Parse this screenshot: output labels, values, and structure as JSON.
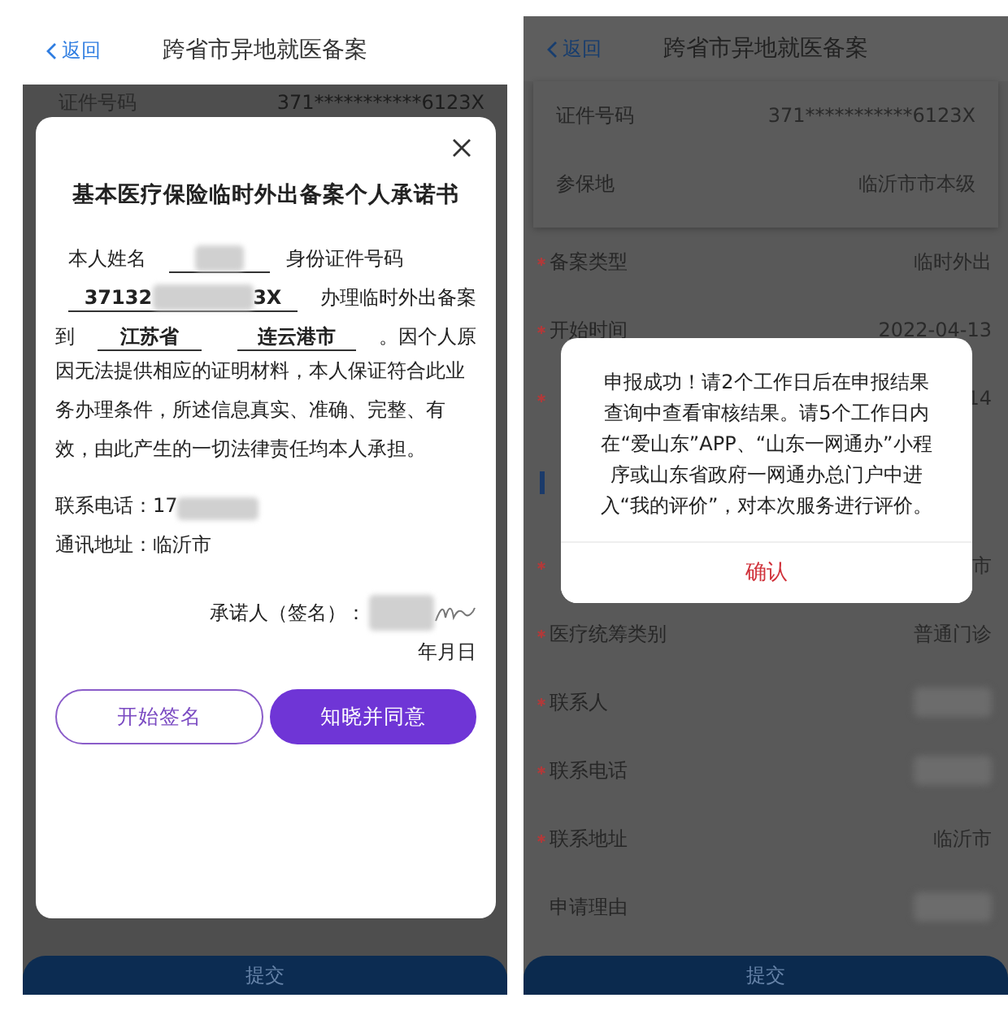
{
  "commitment_screen": {
    "header": {
      "back": "返回",
      "title": "跨省市异地就医备案"
    },
    "background_row": {
      "label": "证件号码",
      "value": "371***********6123X"
    },
    "dialog": {
      "title": "基本医疗保险临时外出备案个人承诺书",
      "name_label": "本人姓名",
      "id_label": "身份证件号码",
      "id_start": "37132",
      "id_end": "3X",
      "action_text": "办理临时外出备案",
      "to_word": "到",
      "province": "江苏省",
      "city": "连云港市",
      "clause_tail": "。因个人原",
      "statement": "因无法提供相应的证明材料，本人保证符合此业务办理条件，所述信息真实、准确、完整、有效，由此产生的一切法律责任均本人承担。",
      "phone_label": "联系电话：",
      "phone_start": "17",
      "address": "通讯地址：临沂市",
      "signer_label": "承诺人（签名）：",
      "date_label": "年月日",
      "buttons": [
        {
          "label": "开始签名",
          "kind": "outline"
        },
        {
          "label": "知晓并同意",
          "kind": "primary"
        }
      ]
    },
    "submit": "提交"
  },
  "success_screen": {
    "header": {
      "back": "返回",
      "title": "跨省市异地就医备案"
    },
    "info_card": [
      {
        "label": "证件号码",
        "value": "371***********6123X"
      },
      {
        "label": "参保地",
        "value": "临沂市市本级"
      }
    ],
    "form_rows": [
      {
        "kind": "field",
        "required": true,
        "label": "备案类型",
        "value": "临时外出",
        "redacted": false
      },
      {
        "kind": "field",
        "required": true,
        "label": "开始时间",
        "value": "2022-04-13",
        "redacted": false
      },
      {
        "kind": "field",
        "required": true,
        "value": "14",
        "redacted": false
      },
      {
        "kind": "section"
      },
      {
        "kind": "field",
        "required": true,
        "value": "市",
        "redacted": false
      },
      {
        "kind": "field",
        "required": true,
        "label": "医疗统筹类别",
        "value": "普通门诊",
        "redacted": false
      },
      {
        "kind": "field",
        "required": true,
        "label": "联系人",
        "redacted": true
      },
      {
        "kind": "field",
        "required": true,
        "label": "联系电话",
        "redacted": true
      },
      {
        "kind": "field",
        "required": true,
        "label": "联系地址",
        "value": "临沂市",
        "redacted": false
      },
      {
        "kind": "field",
        "required": false,
        "label": "申请理由",
        "redacted": true
      }
    ],
    "dialog": {
      "message": "申报成功！请2个工作日后在申报结果查询中查看审核结果。请5个工作日内在“爱山东”APP、“山东一网通办”小程序或山东省政府一网通办总门户中进入“我的评价”，对本次服务进行评价。",
      "confirm": "确认"
    },
    "submit": "提交"
  }
}
